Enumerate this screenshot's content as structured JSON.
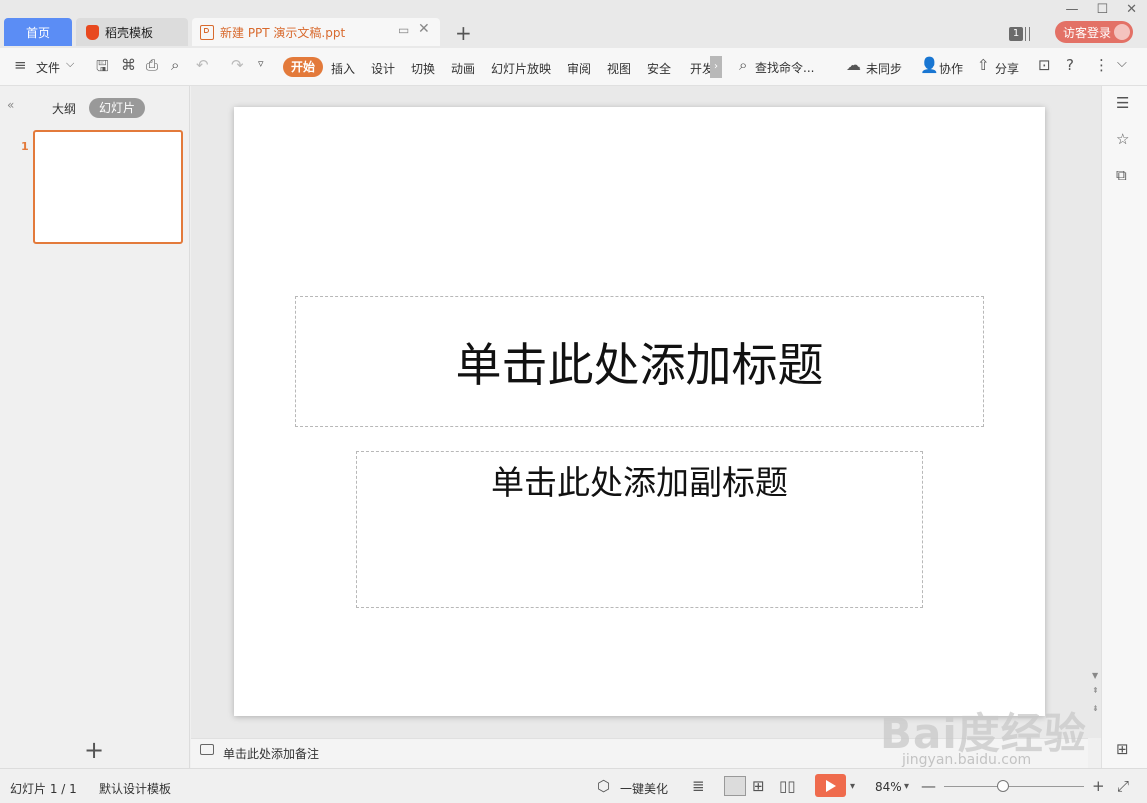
{
  "tabs": {
    "home": "首页",
    "docer": "稻壳模板",
    "document": "新建 PPT 演示文稿.ppt"
  },
  "top_right": {
    "notification_count": "1",
    "login_label": "访客登录"
  },
  "ribbon": {
    "file_label": "文件",
    "menus": [
      "开始",
      "插入",
      "设计",
      "切换",
      "动画",
      "幻灯片放映",
      "审阅",
      "视图",
      "安全",
      "开发"
    ],
    "search_label": "查找命令...",
    "sync_label": "未同步",
    "collab_label": "协作",
    "share_label": "分享"
  },
  "left_panel": {
    "outline_tab": "大纲",
    "slides_tab": "幻灯片",
    "thumb_number": "1"
  },
  "slide": {
    "title_placeholder": "单击此处添加标题",
    "subtitle_placeholder": "单击此处添加副标题"
  },
  "notes_placeholder": "单击此处添加备注",
  "status": {
    "slide_counter": "幻灯片 1 / 1",
    "template_label": "默认设计模板",
    "beautify_label": "一键美化",
    "zoom_level": "84%",
    "zoom_fraction": 0.42
  },
  "watermark": {
    "main": "Bai度经验",
    "sub": "jingyan.baidu.com"
  },
  "colors": {
    "accent": "#e37a3b",
    "home_tab": "#5b8df5",
    "login": "#e37166",
    "play": "#ef6b4d"
  }
}
